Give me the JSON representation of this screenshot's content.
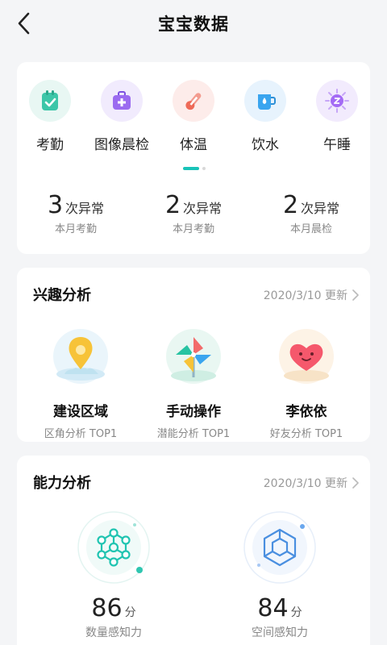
{
  "header": {
    "title": "宝宝数据",
    "back_icon": "chevron-left-icon"
  },
  "categories": [
    {
      "label": "考勤",
      "icon": "attendance-icon",
      "color": "#3cc6a8"
    },
    {
      "label": "图像晨检",
      "icon": "medical-kit-icon",
      "color": "#9b6bf0"
    },
    {
      "label": "体温",
      "icon": "thermometer-icon",
      "color": "#f17b6b"
    },
    {
      "label": "饮水",
      "icon": "water-cup-icon",
      "color": "#3aa5ef"
    },
    {
      "label": "午睡",
      "icon": "sleep-icon",
      "color": "#a46bf5"
    }
  ],
  "pager": {
    "active_color": "#18c3b8"
  },
  "stats": [
    {
      "value": "3",
      "unit": "次异常",
      "label": "本月考勤"
    },
    {
      "value": "2",
      "unit": "次异常",
      "label": "本月考勤"
    },
    {
      "value": "2",
      "unit": "次异常",
      "label": "本月晨检"
    }
  ],
  "interests": {
    "title": "兴趣分析",
    "date": "2020/3/10 更新",
    "items": [
      {
        "name": "建设区域",
        "sub": "区角分析 TOP1",
        "icon": "location-pin-icon"
      },
      {
        "name": "手动操作",
        "sub": "潜能分析 TOP1",
        "icon": "pinwheel-icon"
      },
      {
        "name": "李依依",
        "sub": "好友分析 TOP1",
        "icon": "heart-face-icon"
      }
    ]
  },
  "abilities": {
    "title": "能力分析",
    "date": "2020/3/10 更新",
    "items": [
      {
        "score": "86",
        "unit": "分",
        "label": "数量感知力",
        "icon": "molecule-network-icon",
        "color": "#20c4b1"
      },
      {
        "score": "84",
        "unit": "分",
        "label": "空间感知力",
        "icon": "cube-icon",
        "color": "#4a8fe0"
      }
    ]
  }
}
